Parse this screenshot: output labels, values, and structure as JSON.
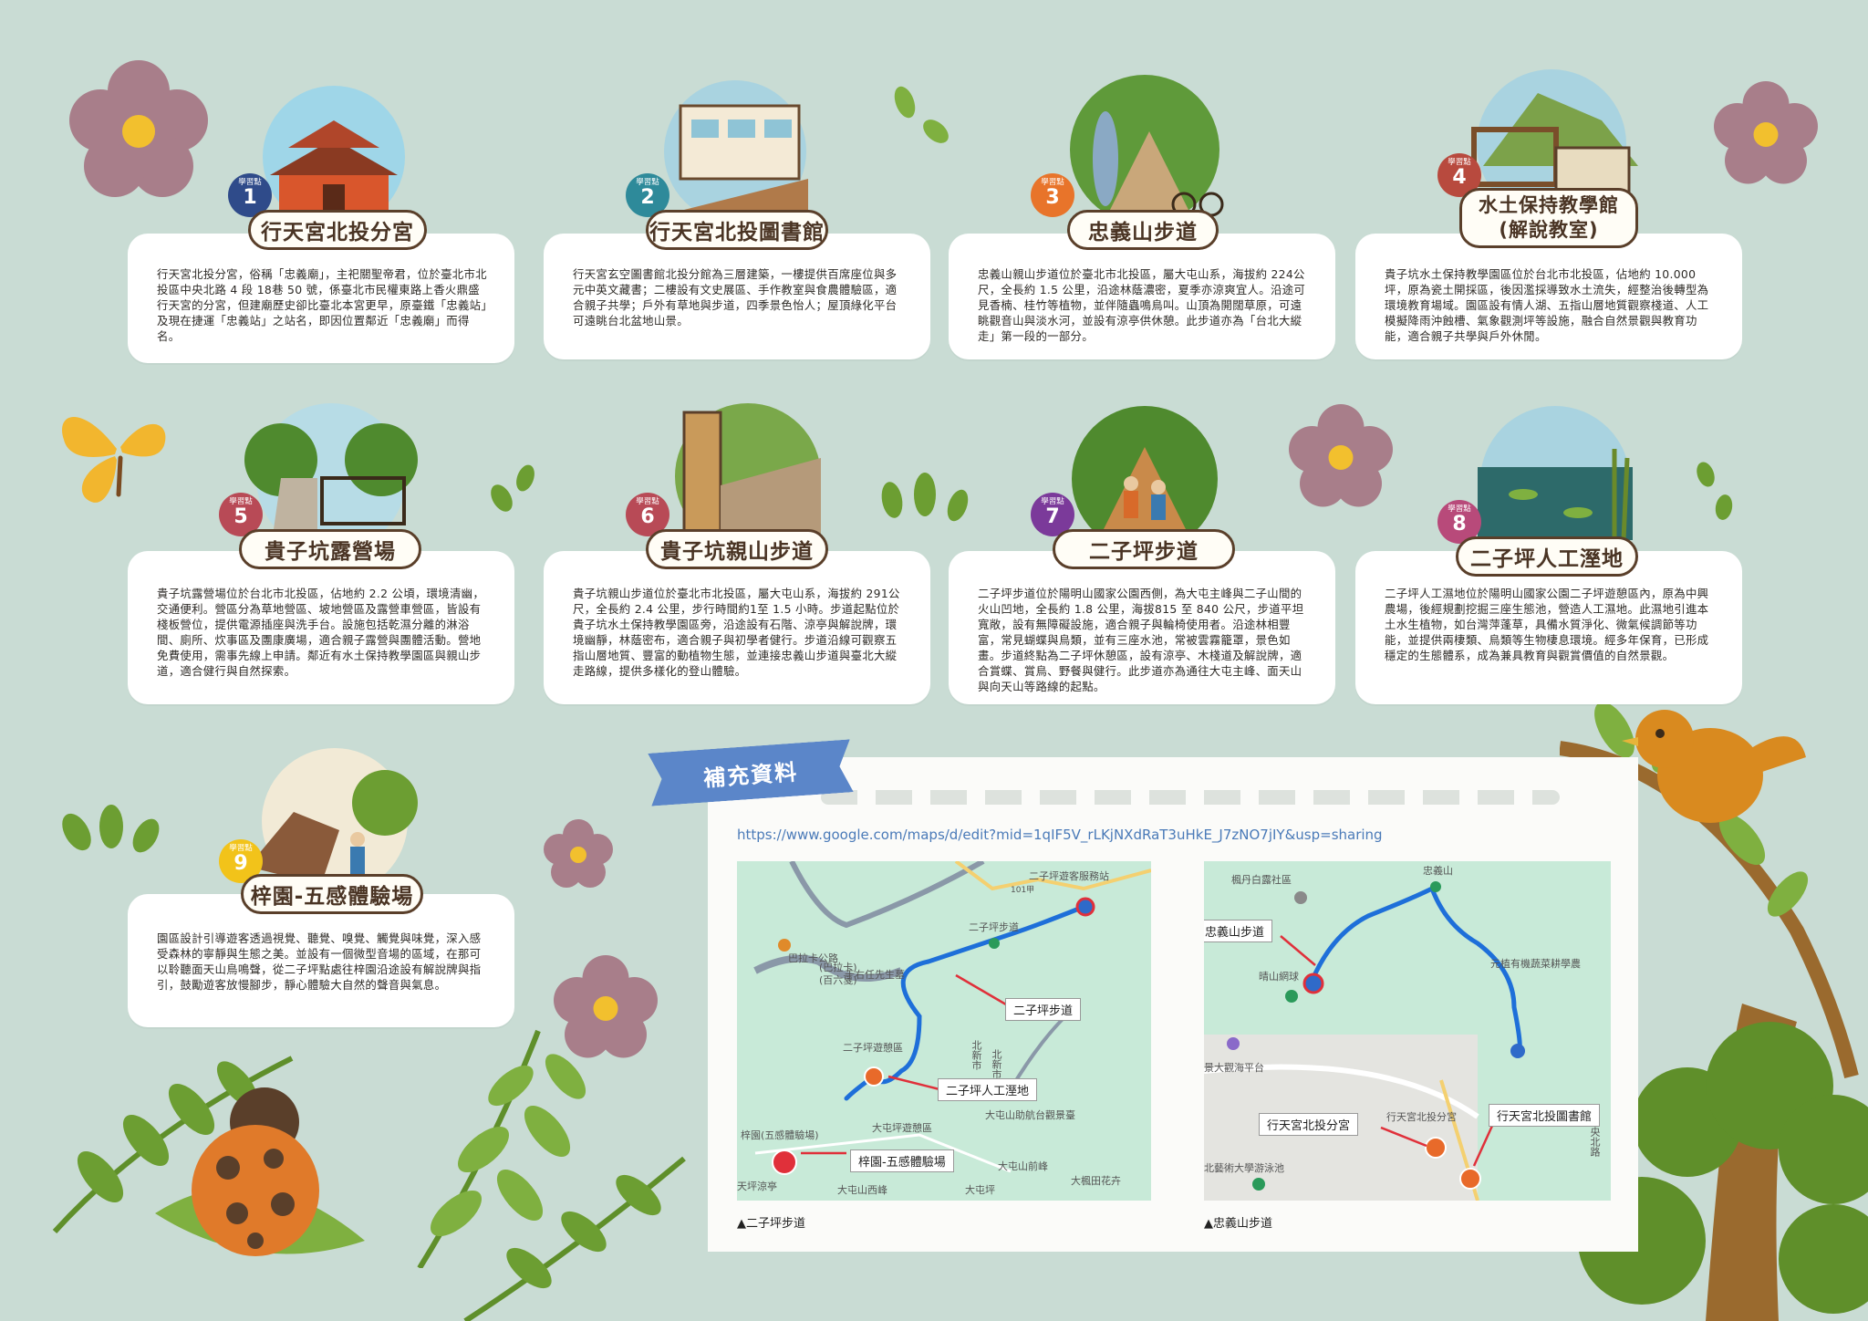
{
  "sites": [
    {
      "badge_label": "學習點",
      "number": "1",
      "title": "行天宮北投分宮",
      "color": "#2f4b8a",
      "text": "行天宮北投分宮，俗稱「忠義廟」，主祀關聖帝君，位於臺北市北投區中央北路 4 段 18巷 50 號，係臺北市民權東路上香火鼎盛行天宮的分宮，但建廟歷史卻比臺北本宮更早，原臺鐵「忠義站」及現在捷運「忠義站」之站名，即因位置鄰近「忠義廟」而得名。"
    },
    {
      "badge_label": "學習點",
      "number": "2",
      "title": "行天宮北投圖書館",
      "color": "#2e8a9a",
      "text": "行天宮玄空圖書館北投分館為三層建築，一樓提供百席座位與多元中英文藏書；二樓設有文史展區、手作教室與食農體驗區，適合親子共學；戶外有草地與步道，四季景色怡人；屋頂綠化平台可遠眺台北盆地山景。"
    },
    {
      "badge_label": "學習點",
      "number": "3",
      "title": "忠義山步道",
      "color": "#e8742a",
      "text": "忠義山親山步道位於臺北市北投區，屬大屯山系，海拔約 224公尺，全長約 1.5 公里，沿途林蔭濃密，夏季亦涼爽宜人。沿途可見香楠、桂竹等植物，並伴隨蟲鳴鳥叫。山頂為開闊草原，可遠眺觀音山與淡水河，並設有涼亭供休憩。此步道亦為「台北大縱走」第一段的一部分。"
    },
    {
      "badge_label": "學習點",
      "number": "4",
      "title_lines": [
        "水土保持教學館",
        "(解說教室)"
      ],
      "color": "#b84a3e",
      "text": "貴子坑水土保持教學園區位於台北市北投區，佔地約 10.000坪，原為瓷土開採區，後因濫採導致水土流失，經整治後轉型為環境教育場域。園區設有情人湖、五指山層地質觀察棧道、人工模擬降雨沖蝕槽、氣象觀測坪等設施，融合自然景觀與教育功能，適合親子共學與戶外休閒。"
    },
    {
      "badge_label": "學習點",
      "number": "5",
      "title": "貴子坑露營場",
      "color": "#b84a56",
      "text": "貴子坑露營場位於台北市北投區，佔地約 2.2 公頃，環境清幽，交通便利。營區分為草地營區、坡地營區及露營車營區，皆設有棧板營位，提供電源插座與洗手台。設施包括乾濕分離的淋浴間、廁所、炊事區及團康廣場，適合親子露營與團體活動。營地免費使用，需事先線上申請。鄰近有水土保持教學園區與親山步道，適合健行與自然探索。"
    },
    {
      "badge_label": "學習點",
      "number": "6",
      "title": "貴子坑親山步道",
      "color": "#b84a56",
      "text": "貴子坑親山步道位於臺北市北投區，屬大屯山系，海拔約 291公尺，全長約 2.4 公里，步行時間約1至 1.5 小時。步道起點位於貴子坑水土保持教學園區旁，沿途設有石階、涼亭與解說牌，環境幽靜，林蔭密布，適合親子與初學者健行。步道沿線可觀察五指山層地質、豐富的動植物生態，並連接忠義山步道與臺北大縱走路線，提供多樣化的登山體驗。"
    },
    {
      "badge_label": "學習點",
      "number": "7",
      "title": "二子坪步道",
      "color": "#7b3a9a",
      "text": "二子坪步道位於陽明山國家公園西側，為大屯主峰與二子山間的火山凹地，全長約 1.8 公里，海拔815 至 840 公尺，步道平坦寬敞，設有無障礙設施，適合親子與輪椅使用者。沿途林相豐富，常見蝴蝶與鳥類，並有三座水池，常被雲霧籠罩，景色如畫。步道終點為二子坪休憩區，設有涼亭、木棧道及解說牌，適合賞蝶、賞鳥、野餐與健行。此步道亦為通往大屯主峰、面天山與向天山等路線的起點。"
    },
    {
      "badge_label": "學習點",
      "number": "8",
      "title": "二子坪人工溼地",
      "color": "#b84a7a",
      "text": "二子坪人工濕地位於陽明山國家公園二子坪遊憩區內，原為中興農場，後經規劃挖掘三座生態池，營造人工濕地。此濕地引進本土水生植物，如台灣萍蓬草，具備水質淨化、微氣候調節等功能，並提供兩棲類、鳥類等生物棲息環境。經多年保育，已形成穩定的生態體系，成為兼具教育與觀賞價值的自然景觀。"
    },
    {
      "badge_label": "學習點",
      "number": "9",
      "title": "梓園-五感體驗場",
      "color": "#f2c31a",
      "text": "園區設計引導遊客透過視覺、聽覺、嗅覺、觸覺與味覺，深入感受森林的寧靜與生態之美。並設有一個微型音場的區域，在那可以聆聽面天山鳥鳴聲，從二子坪點處往梓園沿途設有解說牌與指引，鼓勵遊客放慢腳步，靜心體驗大自然的聲音與氣息。"
    }
  ],
  "supplement": {
    "ribbon_label": "補充資料",
    "url": "https://www.google.com/maps/d/edit?mid=1qIF5V_rLKjNXdRaT3uHkE_J7zNO7jIY&usp=sharing",
    "map1": {
      "caption": "▲二子坪步道",
      "labels": [
        "二子坪步道",
        "二子坪人工溼地",
        "梓園-五感體驗場"
      ],
      "place_texts": [
        "二子坪遊客服務站",
        "巴拉卡公路",
        "二子坪步道",
        "(巴拉卡)",
        "(百六戛)",
        "于右任先生墓",
        "二子坪遊憩區",
        "梓園(五感體驗場)",
        "大屯坪遊憩區",
        "大屯山助航台觀景臺",
        "大屯山前峰",
        "天坪涼亭",
        "大屯山西峰",
        "大屯坪",
        "大楓田花卉",
        "101甲",
        "北新市",
        "北新市"
      ]
    },
    "map2": {
      "caption": "▲忠義山步道",
      "labels": [
        "忠義山步道",
        "行天宮北投分宮",
        "行天宮北投圖書館"
      ],
      "place_texts": [
        "楓丹白露社區",
        "忠義山",
        "晴山網球",
        "元植有機蔬菜耕學農",
        "景大觀海平台",
        "行天宮北投分宮",
        "北藝術大學游泳池",
        "中央北路"
      ]
    }
  },
  "colors": {
    "background": "#c9dcd4",
    "title_border": "#5a3f2a",
    "route": "#1e6fd9",
    "accent_red": "#e0303a"
  }
}
